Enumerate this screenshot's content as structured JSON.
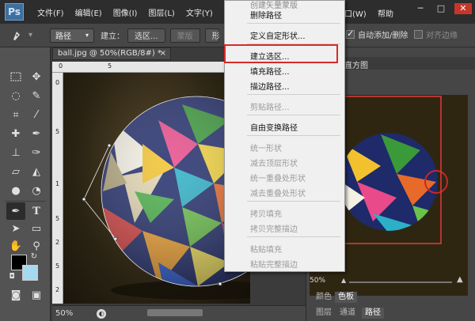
{
  "app": {
    "logo": "Ps"
  },
  "menubar": {
    "items": [
      "文件(F)",
      "编辑(E)",
      "图像(I)",
      "图层(L)",
      "文字(Y)",
      "窗口(W)",
      "帮助"
    ],
    "controls": {
      "minimize": "─",
      "maximize": "□",
      "close": "✕"
    }
  },
  "options": {
    "tool_icon": "pen-icon",
    "mode_dropdown": "路径",
    "make_label": "建立：",
    "make_selection_button": "选区...",
    "mask_button": "蒙版",
    "shape_button": "形",
    "auto_add_delete": {
      "label": "自动添加/删除",
      "checked": true
    },
    "align_edges": {
      "label": "对齐边缘",
      "checked": false
    }
  },
  "toolbox": {
    "tools": [
      "rectangular-marquee-icon",
      "move-icon",
      "lasso-icon",
      "quick-select-icon",
      "crop-icon",
      "eyedropper-icon",
      "healing-brush-icon",
      "brush-icon",
      "clone-stamp-icon",
      "history-brush-icon",
      "eraser-icon",
      "paint-bucket-icon",
      "blur-icon",
      "dodge-icon",
      "pen-icon",
      "type-icon",
      "path-select-icon",
      "shape-icon",
      "hand-icon",
      "zoom-icon"
    ],
    "fg_color": "#000000",
    "bg_color": "#a6d9ee"
  },
  "document": {
    "tab_title": "ball.jpg @ 50%(RGB/8#) *",
    "tab_close": "×",
    "ruler_top": [
      "0",
      "5"
    ],
    "ruler_left": [
      "0",
      "5",
      "1",
      "5",
      "2",
      "5",
      "2"
    ],
    "zoom": "50%"
  },
  "context_menu": {
    "items": [
      {
        "label": "创建矢量蒙版",
        "disabled": false
      },
      {
        "label": "删除路径",
        "disabled": false
      },
      {
        "separator": true
      },
      {
        "label": "定义自定形状...",
        "disabled": false
      },
      {
        "separator": true
      },
      {
        "label": "建立选区...",
        "disabled": false,
        "highlighted": true
      },
      {
        "label": "填充路径...",
        "disabled": false
      },
      {
        "label": "描边路径...",
        "disabled": false
      },
      {
        "separator": true
      },
      {
        "label": "剪贴路径...",
        "disabled": true
      },
      {
        "separator": true
      },
      {
        "label": "自由变换路径",
        "disabled": false
      },
      {
        "separator": true
      },
      {
        "label": "统一形状",
        "disabled": true
      },
      {
        "label": "减去顶层形状",
        "disabled": true
      },
      {
        "label": "统一重叠处形状",
        "disabled": true
      },
      {
        "label": "减去重叠处形状",
        "disabled": true
      },
      {
        "separator": true
      },
      {
        "label": "拷贝填充",
        "disabled": true
      },
      {
        "label": "拷贝完整描边",
        "disabled": true
      },
      {
        "separator": true
      },
      {
        "label": "粘贴填充",
        "disabled": true
      },
      {
        "label": "粘贴完整描边",
        "disabled": true
      }
    ],
    "highlight_color": "#d92a2a"
  },
  "right_panel": {
    "navigator_title": "直方图",
    "zoom": "50%",
    "color_tabs": [
      "颜色",
      "色板"
    ],
    "layer_tabs": [
      "图层",
      "通道",
      "路径"
    ]
  }
}
